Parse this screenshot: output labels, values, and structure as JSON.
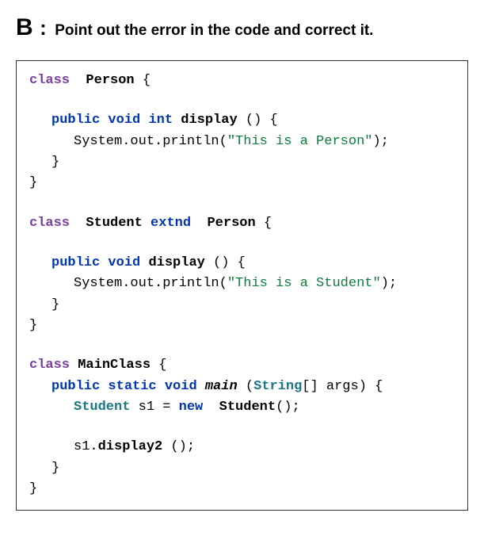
{
  "header": {
    "letter": "B",
    "colon": ":",
    "prompt": "Point out the error in the code and correct it."
  },
  "code": {
    "kw_class": "class",
    "kw_public": "public",
    "kw_void": "void",
    "kw_int": "int",
    "kw_static": "static",
    "kw_new": "new",
    "kw_extnd": "extnd",
    "cls_Person": "Person",
    "cls_Student": "Student",
    "cls_MainClass": "MainClass",
    "fn_display": "display",
    "fn_main": "main",
    "fn_display2": "display2",
    "type_String": "String",
    "var_s1": "s1",
    "str_person": "\"This is a Person\"",
    "str_student": "\"This is a Student\"",
    "sysout": "System.out.println(",
    "open_brace": " {",
    "close_brace": "}",
    "parens_empty": " ()",
    "parens_close_semi": ");",
    "args_decl": "[] args)",
    "open_paren": " (",
    "eq": " = ",
    "ctor_call": "();",
    "semi": " ();"
  }
}
